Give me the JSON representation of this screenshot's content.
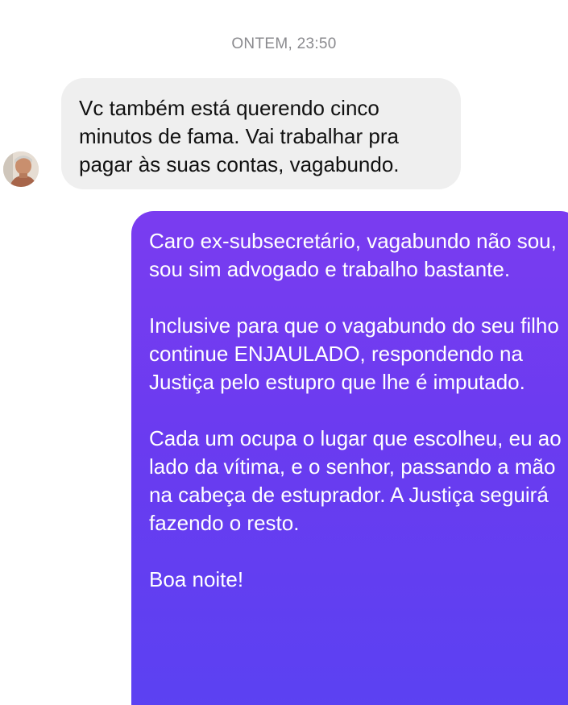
{
  "conversation": {
    "timestamp": "ONTEM, 23:50",
    "incoming_message": {
      "text": "Vc também está querendo cinco minutos de fama. Vai trabalhar pra pagar às suas contas, vagabundo."
    },
    "outgoing_message": {
      "paragraphs": [
        "Caro ex-subsecretário, vagabundo não sou, sou sim advogado e trabalho bastante.",
        "Inclusive para que o vagabundo do seu filho continue ENJAULADO, respondendo na Justiça pelo estupro que lhe é imputado.",
        "Cada um ocupa o lugar que escolheu, eu ao lado da vítima, e o senhor, passando a mão na cabeça de estuprador. A Justiça seguirá fazendo o resto.",
        "Boa noite!"
      ]
    }
  },
  "colors": {
    "incoming_bubble": "#efefef",
    "outgoing_gradient_top": "#7a3cf0",
    "outgoing_gradient_bottom": "#5a42f2",
    "timestamp_text": "#8a8a8e"
  }
}
